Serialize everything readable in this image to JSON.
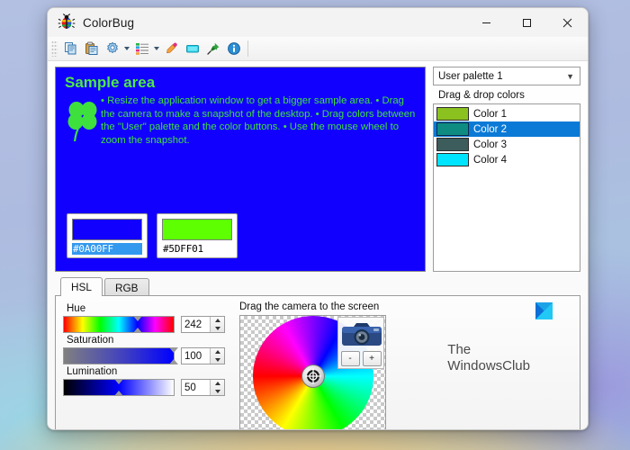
{
  "window": {
    "title": "ColorBug",
    "app_icon": "colorbug-bug-icon",
    "minimize_label": "Minimize",
    "maximize_label": "Maximize",
    "close_label": "Close"
  },
  "toolbar": {
    "items": [
      {
        "name": "copy-icon",
        "tooltip": "Copy",
        "has_caret": false
      },
      {
        "name": "paste-icon",
        "tooltip": "Paste",
        "has_caret": false
      },
      {
        "name": "settings-icon",
        "tooltip": "Settings",
        "has_caret": true
      },
      {
        "name": "list-icon",
        "tooltip": "Palette list",
        "has_caret": true
      },
      {
        "name": "eyedropper-icon",
        "tooltip": "Pick color",
        "has_caret": false
      },
      {
        "name": "screen-icon",
        "tooltip": "Capture screen",
        "has_caret": false
      },
      {
        "name": "pin-icon",
        "tooltip": "Always on top",
        "has_caret": false
      },
      {
        "name": "info-icon",
        "tooltip": "About",
        "has_caret": false
      }
    ]
  },
  "sample_area": {
    "background_color": "#1200FF",
    "title": "Sample area",
    "text_color": "#3EE03E",
    "body": "• Resize the application window to get a bigger sample area. • Drag the camera to make a snapshot of the desktop. • Drag colors between the \"User\" palette and the color buttons. • Use the mouse wheel to zoom the snapshot.",
    "swatches": [
      {
        "name": "foreground-color",
        "hex": "#0A00FF",
        "chip_color": "#1200FF",
        "selected": true
      },
      {
        "name": "background-color",
        "hex": "#5DFF01",
        "chip_color": "#5DFF01",
        "selected": false
      }
    ]
  },
  "palette": {
    "selected_palette": "User palette 1",
    "dropdown_options": [
      "User palette 1"
    ],
    "hint": "Drag & drop colors",
    "colors": [
      {
        "label": "Color 1",
        "hex": "#8CC220",
        "selected": false
      },
      {
        "label": "Color 2",
        "hex": "#0E8C82",
        "selected": true
      },
      {
        "label": "Color 3",
        "hex": "#3D5C5C",
        "selected": false
      },
      {
        "label": "Color 4",
        "hex": "#00E5FF",
        "selected": false
      }
    ]
  },
  "tabs": [
    {
      "label": "HSL",
      "active": true
    },
    {
      "label": "RGB",
      "active": false
    }
  ],
  "sliders": [
    {
      "label": "Hue",
      "value": "242",
      "percent": 67,
      "gradient": "linear-gradient(90deg,#ff0000 0%,#ffff00 17%,#00ff00 33%,#00ffff 50%,#0000ff 67%,#ff00ff 83%,#ff0000 100%)"
    },
    {
      "label": "Saturation",
      "value": "100",
      "percent": 100,
      "gradient": "linear-gradient(90deg,#808080 0%,#4040c0 55%,#0000ff 100%)"
    },
    {
      "label": "Lumination",
      "value": "50",
      "percent": 50,
      "gradient": "linear-gradient(90deg,#000000 0%,#0000ff 50%,#ffffff 100%)"
    }
  ],
  "camera": {
    "label": "Drag the camera to the screen",
    "icon": "camera-icon",
    "zoom_out_label": "-",
    "zoom_in_label": "+"
  },
  "watermark": {
    "line1": "The",
    "line2": "WindowsClub",
    "logo": "windowsclub-logo"
  }
}
